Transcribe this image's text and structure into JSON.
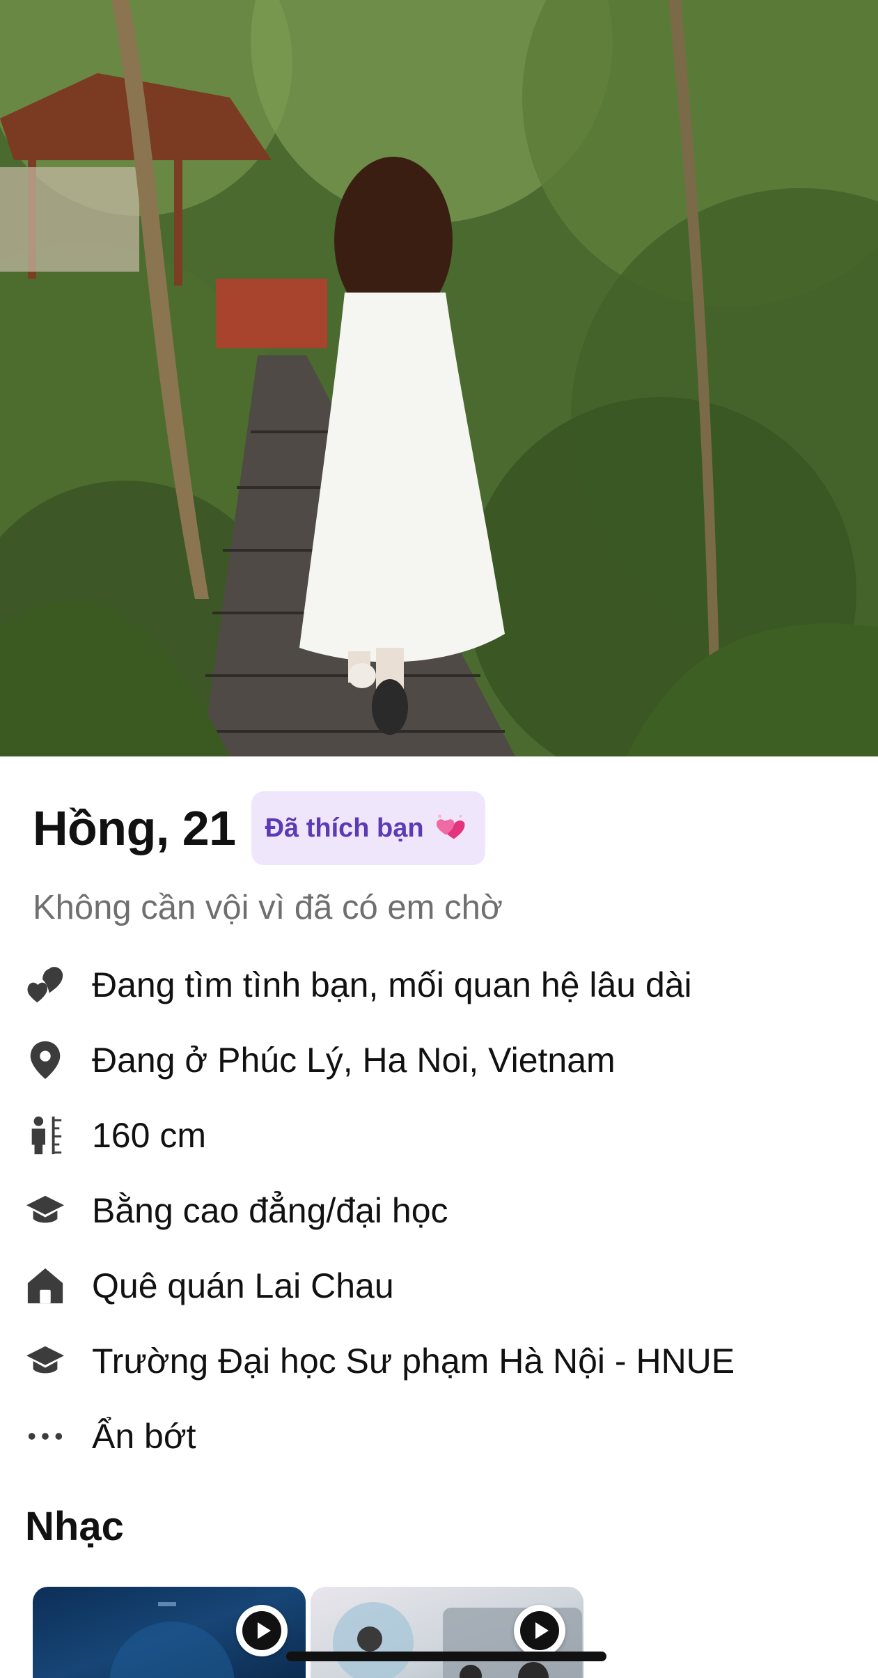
{
  "profile": {
    "name_age": "Hồng, 21",
    "liked_badge": "Đã thích bạn",
    "liked_badge_icon": "sparkling-hearts-emoji",
    "tagline": "Không cần vội vì đã có em chờ",
    "photo_icon": "profile-photo"
  },
  "details": [
    {
      "icon": "hearts-icon",
      "text": "Đang tìm tình bạn, mối quan hệ lâu dài"
    },
    {
      "icon": "location-pin-icon",
      "text": "Đang ở Phúc Lý, Ha Noi, Vietnam"
    },
    {
      "icon": "height-icon",
      "text": "160 cm"
    },
    {
      "icon": "graduation-cap-icon",
      "text": "Bằng cao đẳng/đại học"
    },
    {
      "icon": "home-icon",
      "text": "Quê quán Lai Chau"
    },
    {
      "icon": "graduation-cap-icon",
      "text": "Trường Đại học Sư phạm Hà Nội - HNUE"
    },
    {
      "icon": "more-dots-icon",
      "text": "Ẩn bớt"
    }
  ],
  "music": {
    "title": "Nhạc",
    "cards": [
      {
        "icon": "play-icon"
      },
      {
        "icon": "play-icon"
      }
    ]
  },
  "colors": {
    "badge_bg": "#efe6fb",
    "badge_text": "#5b3ab3",
    "tagline": "#6f6f6f",
    "text": "#111111"
  }
}
